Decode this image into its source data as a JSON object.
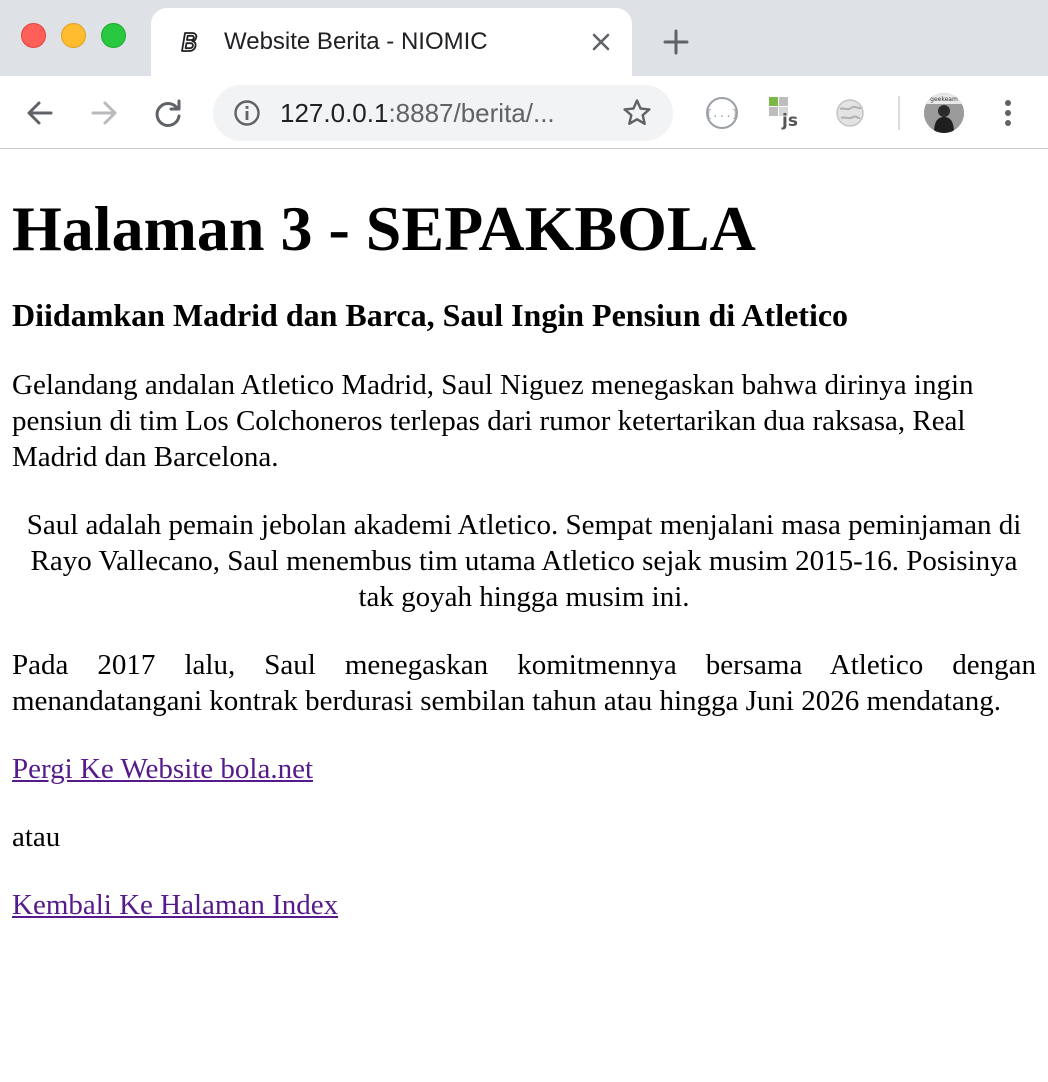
{
  "browser": {
    "tab": {
      "title": "Website Berita - NIOMIC"
    },
    "url": {
      "host": "127.0.0.1",
      "rest": ":8887/berita/..."
    },
    "extensions": [
      "json-formatter-icon",
      "js-extension-icon",
      "globe-extension-icon"
    ],
    "avatar_label": "geekeam"
  },
  "page": {
    "heading": "Halaman 3 - SEPAKBOLA",
    "subheading": "Diidamkan Madrid dan Barca, Saul Ingin Pensiun di Atletico",
    "paragraphs": [
      "Gelandang andalan Atletico Madrid, Saul Niguez menegaskan bahwa dirinya ingin pensiun di tim Los Colchoneros terlepas dari rumor ketertarikan dua raksasa, Real Madrid dan Barcelona.",
      "Saul adalah pemain jebolan akademi Atletico. Sempat menjalani masa peminjaman di Rayo Vallecano, Saul menembus tim utama Atletico sejak musim 2015-16. Posisinya tak goyah hingga musim ini.",
      "Pada 2017 lalu, Saul menegaskan komitmennya bersama Atletico dengan menandatangani kontrak berdurasi sembilan tahun atau hingga Juni 2026 mendatang."
    ],
    "link_external": "Pergi Ke Website bola.net",
    "separator": "atau",
    "link_index": "Kembali Ke Halaman Index"
  },
  "colors": {
    "link_visited": "#551a8b",
    "tabstrip": "#dee1e6",
    "omnibox": "#f1f3f4"
  }
}
